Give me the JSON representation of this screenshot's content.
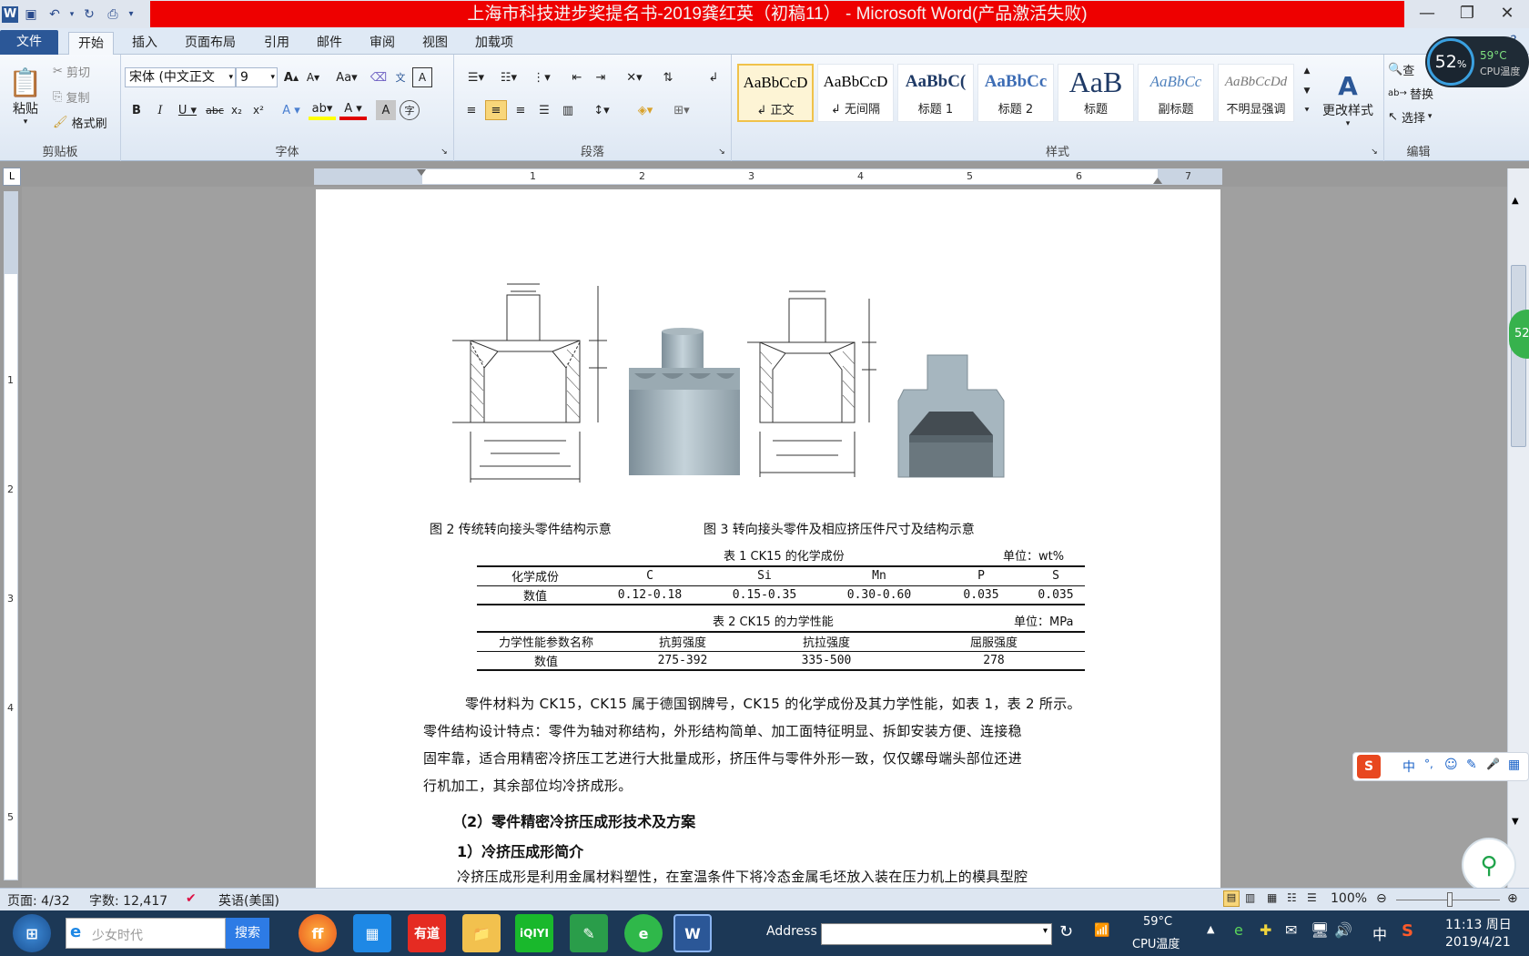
{
  "window": {
    "title": "上海市科技进步奖提名书-2019龚红英（初稿11） - Microsoft Word(产品激活失败)"
  },
  "tabs": [
    "文件",
    "开始",
    "插入",
    "页面布局",
    "引用",
    "邮件",
    "审阅",
    "视图",
    "加载项"
  ],
  "ribbon": {
    "clipboard": {
      "paste": "粘贴",
      "cut": "剪切",
      "copy": "复制",
      "format_painter": "格式刷",
      "label": "剪贴板"
    },
    "font": {
      "name": "宋体 (中文正文",
      "size": "9",
      "label": "字体"
    },
    "paragraph": {
      "label": "段落"
    },
    "styles": {
      "label": "样式",
      "items": [
        {
          "sample": "AaBbCcD",
          "name": "↲ 正文"
        },
        {
          "sample": "AaBbCcD",
          "name": "↲ 无间隔"
        },
        {
          "sample": "AaBbC(",
          "name": "标题 1"
        },
        {
          "sample": "AaBbCc",
          "name": "标题 2"
        },
        {
          "sample": "AaB",
          "name": "标题"
        },
        {
          "sample": "AaBbCc",
          "name": "副标题"
        },
        {
          "sample": "AaBbCcDd",
          "name": "不明显强调"
        }
      ],
      "change": "更改样式"
    },
    "editing": {
      "find": "查",
      "replace": "替换",
      "select": "选择",
      "label": "编辑"
    }
  },
  "cpu_widget": {
    "percent": "52",
    "unit": "%",
    "temp": "59°C",
    "label": "CPU温度"
  },
  "ruler": {
    "numbers": [
      "1",
      "2",
      "3",
      "4",
      "5",
      "6",
      "7"
    ],
    "vnumbers": [
      "1",
      "2",
      "3",
      "4",
      "5"
    ]
  },
  "document": {
    "fig2_caption": "图 2 传统转向接头零件结构示意",
    "fig3_caption": "图 3 转向接头零件及相应挤压件尺寸及结构示意",
    "table1": {
      "title": "表 1 CK15 的化学成份",
      "unit": "单位：wt%",
      "header": [
        "化学成份",
        "C",
        "Si",
        "Mn",
        "P",
        "S"
      ],
      "row": [
        "数值",
        "0.12-0.18",
        "0.15-0.35",
        "0.30-0.60",
        "0.035",
        "0.035"
      ]
    },
    "table2": {
      "title": "表 2 CK15 的力学性能",
      "unit": "单位：MPa",
      "header": [
        "力学性能参数名称",
        "抗剪强度",
        "抗拉强度",
        "屈服强度"
      ],
      "row": [
        "数值",
        "275-392",
        "335-500",
        "278"
      ]
    },
    "para1": [
      "零件材料为 CK15，CK15 属于德国钢牌号，CK15 的化学成份及其力学性能，如表 1，表 2 所示。",
      "零件结构设计特点：零件为轴对称结构，外形结构简单、加工面特征明显、拆卸安装方便、连接稳",
      "固牢靠，适合用精密冷挤压工艺进行大批量成形，挤压件与零件外形一致，仅仅螺母端头部位还进",
      "行机加工，其余部位均冷挤成形。"
    ],
    "heading1": "（2）零件精密冷挤压成形技术及方案",
    "heading2": "1）冷挤压成形简介",
    "para2": "冷挤压成形是利用金属材料塑性，在室温条件下将冷态金属毛坯放入装在压力机上的模具型腔"
  },
  "statusbar": {
    "page": "页面: 4/32",
    "words": "字数: 12,417",
    "lang": "英语(美国)",
    "zoom": "100%"
  },
  "ime": {
    "items": [
      "中",
      "°,",
      "☺",
      "✎",
      "🎤",
      "▦"
    ]
  },
  "taskbar": {
    "search_placeholder": "少女时代",
    "search_btn": "搜索",
    "address_label": "Address",
    "temp": "59°C",
    "temp_label": "CPU温度",
    "ime": "中",
    "time": "11:13 周日",
    "date": "2019/4/21"
  }
}
